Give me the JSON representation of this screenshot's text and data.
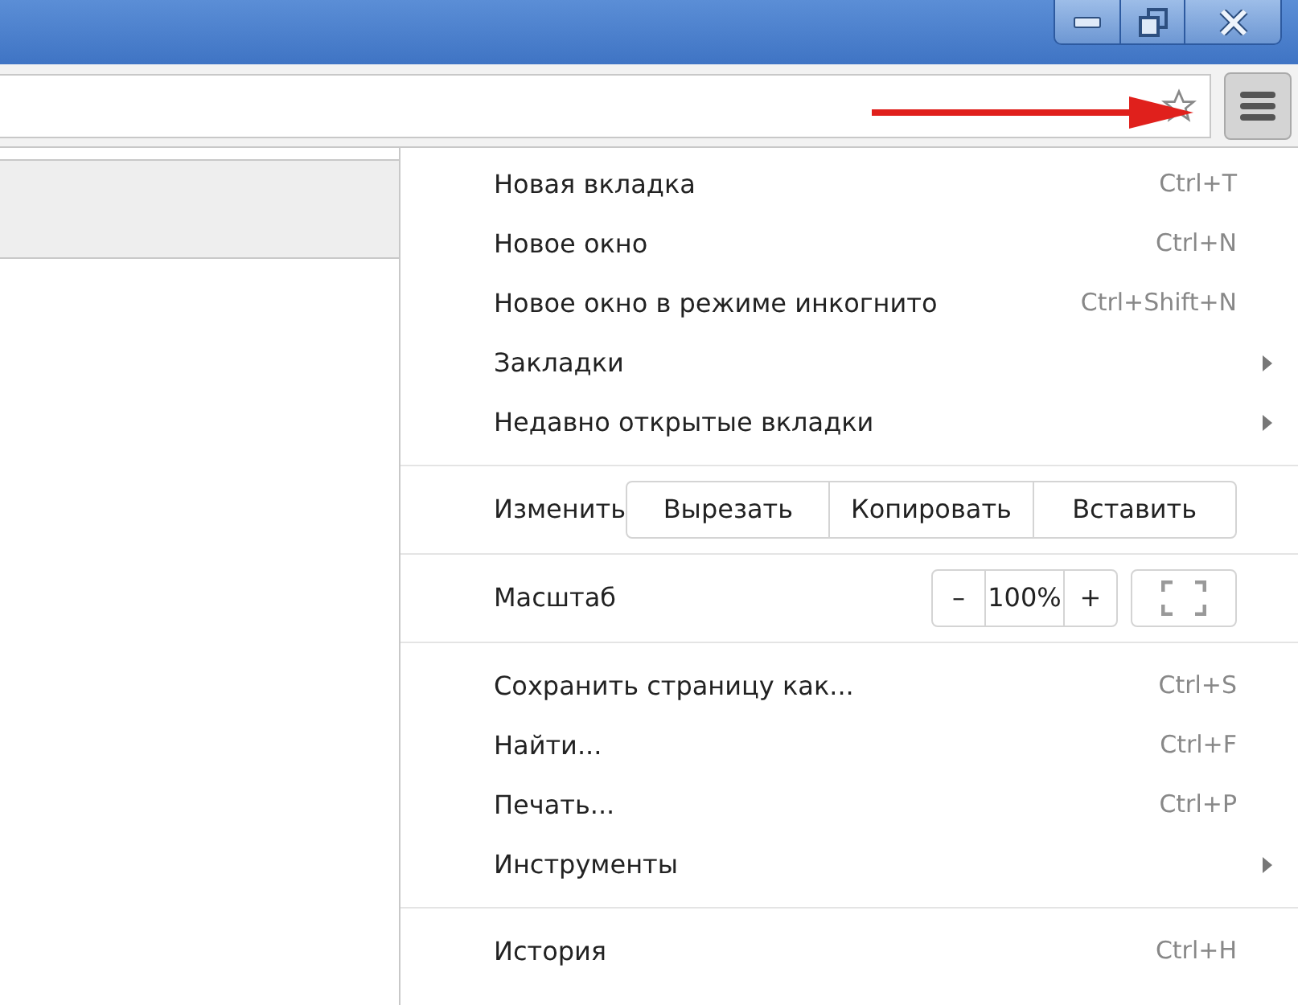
{
  "window_controls": [
    {
      "kind": "minimize"
    },
    {
      "kind": "restore"
    },
    {
      "kind": "close"
    }
  ],
  "menu": [
    {
      "kind": "command",
      "label": "Новая вкладка",
      "shortcut": "Ctrl+T"
    },
    {
      "kind": "command",
      "label": "Новое окно",
      "shortcut": "Ctrl+N"
    },
    {
      "kind": "command",
      "label": "Новое окно в режиме инкогнито",
      "shortcut": "Ctrl+Shift+N"
    },
    {
      "kind": "submenu",
      "label": "Закладки"
    },
    {
      "kind": "submenu",
      "label": "Недавно открытые вкладки"
    },
    {
      "kind": "separator"
    },
    {
      "kind": "edit",
      "label": "Изменить",
      "buttons": [
        "Вырезать",
        "Копировать",
        "Вставить"
      ]
    },
    {
      "kind": "separator"
    },
    {
      "kind": "zoom",
      "label": "Масштаб",
      "minus": "–",
      "value": "100%",
      "plus": "+"
    },
    {
      "kind": "separator"
    },
    {
      "kind": "command",
      "label": "Сохранить страницу как...",
      "shortcut": "Ctrl+S"
    },
    {
      "kind": "command",
      "label": "Найти...",
      "shortcut": "Ctrl+F"
    },
    {
      "kind": "command",
      "label": "Печать...",
      "shortcut": "Ctrl+P"
    },
    {
      "kind": "submenu",
      "label": "Инструменты"
    },
    {
      "kind": "separator"
    },
    {
      "kind": "command",
      "label": "История",
      "shortcut": "Ctrl+H"
    }
  ]
}
